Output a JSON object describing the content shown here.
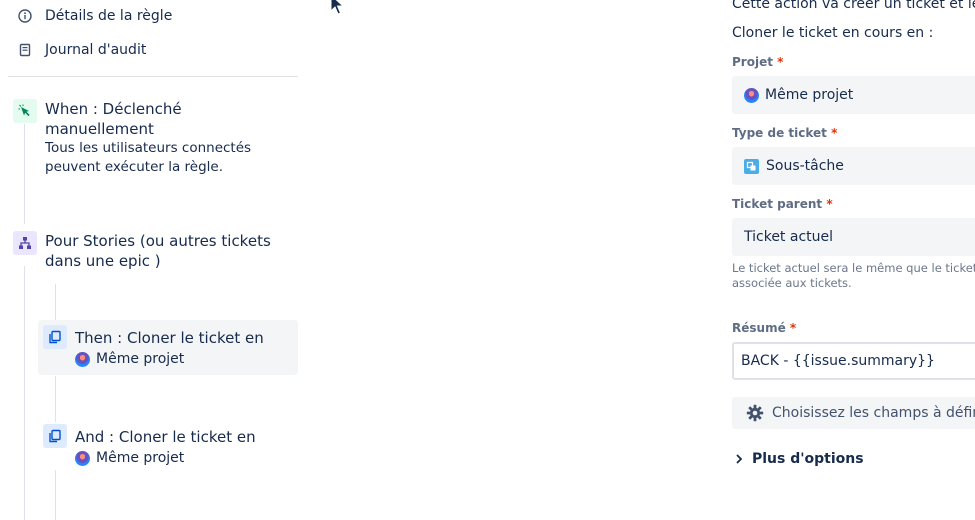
{
  "left_nav": {
    "rule_details_label": "Détails de la règle",
    "audit_log_label": "Journal d'audit"
  },
  "rule": {
    "trigger": {
      "title_line1": "When : Déclenché",
      "title_line2": "manuellement",
      "sub_line1": "Tous les utilisateurs connectés",
      "sub_line2": "peuvent exécuter la règle."
    },
    "branch": {
      "title_line1": "Pour Stories (ou autres tickets",
      "title_line2": "dans une epic )"
    },
    "actions": [
      {
        "title": "Then : Cloner le ticket en",
        "project": "Même projet"
      },
      {
        "title": "And : Cloner le ticket en",
        "project": "Même projet"
      }
    ]
  },
  "form": {
    "intro": "Cette action va créer un ticket et le c",
    "clone_into_label": "Cloner le ticket en cours en :",
    "project": {
      "label": "Projet",
      "value": "Même projet"
    },
    "issue_type": {
      "label": "Type de ticket",
      "value": "Sous-tâche"
    },
    "parent": {
      "label": "Ticket parent",
      "value": "Ticket actuel",
      "help_line1": "Le ticket actuel sera le même que le ticket d",
      "help_line2": "associée aux tickets."
    },
    "summary": {
      "label": "Résumé",
      "value": "BACK - {{issue.summary}}"
    },
    "required_marker": "*",
    "choose_fields_label": "Choisissez les champs à défin",
    "more_options_label": "Plus d'options"
  },
  "colors": {
    "required": "#de350b",
    "trigger_icon_bg": "#e3fcef",
    "branch_icon_bg": "#eae6ff",
    "action_icon_bg": "#deebff",
    "selected_bg": "#f4f5f7"
  }
}
